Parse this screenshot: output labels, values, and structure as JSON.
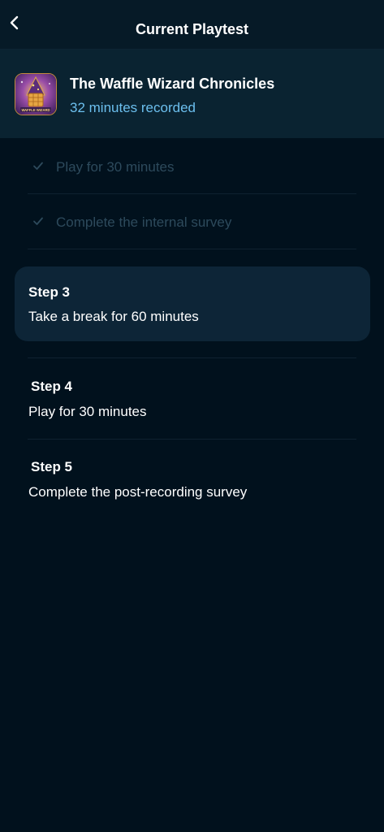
{
  "nav": {
    "title": "Current Playtest",
    "back_icon": "chevron-left-icon"
  },
  "game": {
    "title": "The Waffle Wizard Chronicles",
    "recorded": "32 minutes recorded",
    "icon_label": "WAFFLE WIZARD",
    "icon": "game-app-icon"
  },
  "steps": [
    {
      "heading": "",
      "label": "Play for 30 minutes",
      "status": "completed",
      "icon": "check-icon"
    },
    {
      "heading": "",
      "label": "Complete the internal survey",
      "status": "completed",
      "icon": "check-icon"
    },
    {
      "heading": "Step 3",
      "label": "Take a break for 60 minutes",
      "status": "current"
    },
    {
      "heading": "Step 4",
      "label": "Play for 30 minutes",
      "status": "upcoming"
    },
    {
      "heading": "Step 5",
      "label": "Complete the post-recording survey",
      "status": "upcoming"
    }
  ],
  "colors": {
    "background": "#01111d",
    "header": "#0a2331",
    "accent": "#6cbfee",
    "completed_text": "#2d4a5c",
    "active_card": "#0d2537"
  }
}
